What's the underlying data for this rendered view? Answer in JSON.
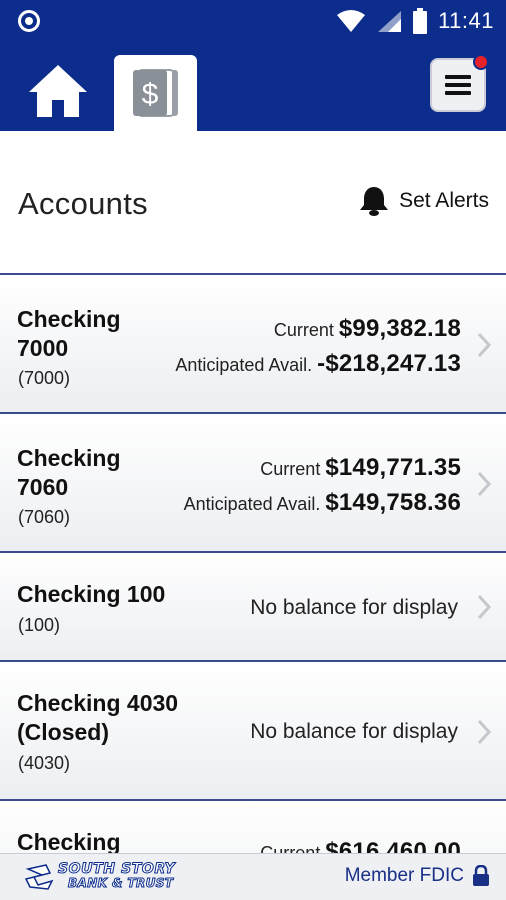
{
  "status_bar": {
    "time": "11:41"
  },
  "nav": {
    "home_icon": "home-icon",
    "accounts_icon": "dollar-document-icon",
    "menu_icon": "hamburger-menu-icon",
    "brand_color": "#0d2d8c",
    "notification_color": "#e8202a"
  },
  "header": {
    "title": "Accounts",
    "set_alerts_label": "Set Alerts"
  },
  "accounts": [
    {
      "name_line1": "Checking",
      "name_line2": "7000",
      "number": "(7000)",
      "current_label": "Current",
      "current": "$99,382.18",
      "avail_label": "Anticipated Avail.",
      "avail": "-$218,247.13"
    },
    {
      "name_line1": "Checking",
      "name_line2": "7060",
      "number": "(7060)",
      "current_label": "Current",
      "current": "$149,771.35",
      "avail_label": "Anticipated Avail.",
      "avail": "$149,758.36"
    },
    {
      "name": "Checking 100",
      "number": "(100)",
      "no_balance": "No balance for display"
    },
    {
      "name_line1": "Checking 4030",
      "name_line2": "(Closed)",
      "number": "(4030)",
      "no_balance": "No balance for display"
    },
    {
      "name_line1": "Checking",
      "current_label": "Current",
      "current": "$616,460.00"
    }
  ],
  "footer": {
    "bank_line1": "SOUTH STORY",
    "bank_line2": "BANK & TRUST",
    "fdic_label": "Member FDIC"
  }
}
